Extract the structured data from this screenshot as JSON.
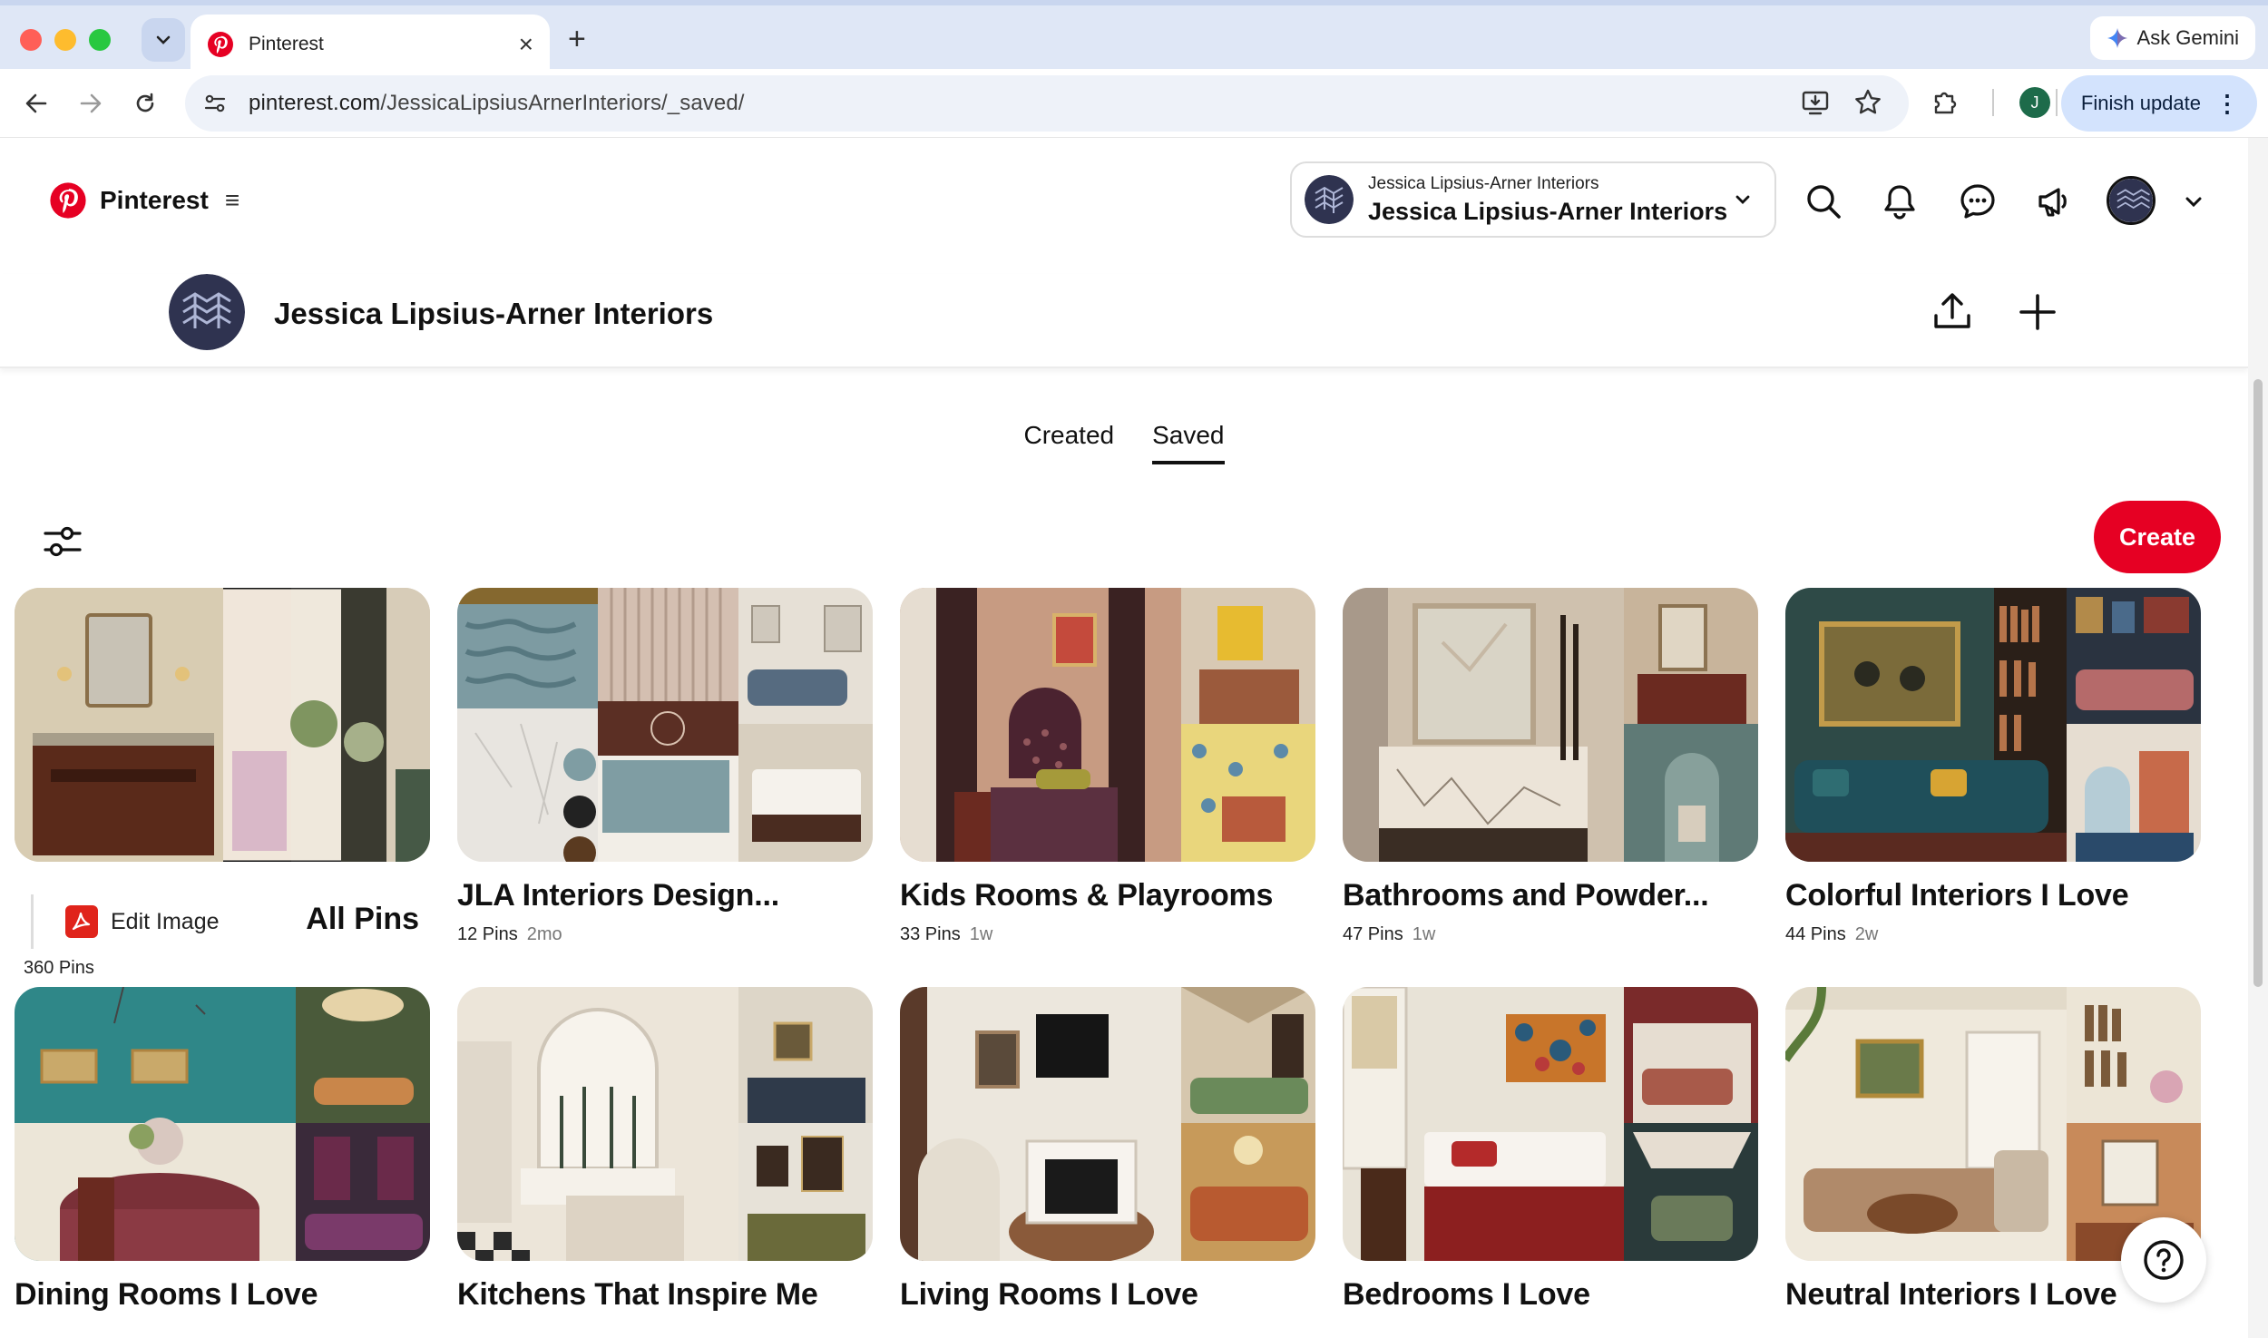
{
  "browser": {
    "tab_title": "Pinterest",
    "ask_gemini": "Ask Gemini",
    "url_host": "pinterest.com",
    "url_path": "/JessicaLipsiusArnerInteriors/_saved/",
    "finish_update": "Finish update",
    "profile_initial": "J"
  },
  "header": {
    "logo_text": "Pinterest",
    "account_small": "Jessica Lipsius-Arner Interiors",
    "account_name": "Jessica Lipsius-Arner Interiors"
  },
  "profile": {
    "name": "Jessica Lipsius-Arner Interiors"
  },
  "tabs": [
    {
      "label": "Created",
      "active": false
    },
    {
      "label": "Saved",
      "active": true
    }
  ],
  "create_label": "Create",
  "all_pins": {
    "edit_image": "Edit Image",
    "label": "All Pins",
    "count": "360 Pins"
  },
  "boards": [
    {
      "title": "JLA Interiors Design...",
      "pins": "12 Pins",
      "age": "2mo"
    },
    {
      "title": "Kids Rooms & Playrooms",
      "pins": "33 Pins",
      "age": "1w"
    },
    {
      "title": "Bathrooms and Powder...",
      "pins": "47 Pins",
      "age": "1w"
    },
    {
      "title": "Colorful Interiors I Love",
      "pins": "44 Pins",
      "age": "2w"
    },
    {
      "title": "Dining Rooms I Love"
    },
    {
      "title": "Kitchens That Inspire Me"
    },
    {
      "title": "Living Rooms I Love"
    },
    {
      "title": "Bedrooms I Love"
    },
    {
      "title": "Neutral Interiors I Love"
    }
  ],
  "colors": {
    "pinterest_red": "#e60023",
    "chrome_tabstrip": "#dfe7f6",
    "omnibox": "#eef2f9",
    "finish_update_bg": "#d3e3fd"
  }
}
